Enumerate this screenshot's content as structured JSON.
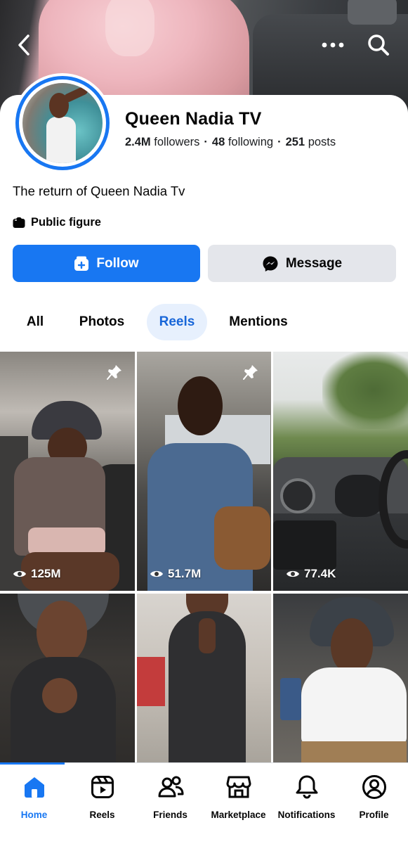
{
  "profile": {
    "name": "Queen Nadia TV",
    "followers_count": "2.4M",
    "followers_label": "followers",
    "following_count": "48",
    "following_label": "following",
    "posts_count": "251",
    "posts_label": "posts",
    "bio": "The return of Queen Nadia Tv",
    "category": "Public figure"
  },
  "actions": {
    "follow_label": "Follow",
    "message_label": "Message"
  },
  "tabs": [
    {
      "label": "All",
      "active": false
    },
    {
      "label": "Photos",
      "active": false
    },
    {
      "label": "Reels",
      "active": true
    },
    {
      "label": "Mentions",
      "active": false
    }
  ],
  "reels": [
    {
      "views": "125M",
      "pinned": true
    },
    {
      "views": "51.7M",
      "pinned": true
    },
    {
      "views": "77.4K",
      "pinned": false
    },
    {
      "views": "",
      "pinned": false
    },
    {
      "views": "",
      "pinned": false
    },
    {
      "views": "",
      "pinned": false
    }
  ],
  "bottom_nav": [
    {
      "label": "Home",
      "icon": "home-icon",
      "active": true
    },
    {
      "label": "Reels",
      "icon": "reels-icon",
      "active": false
    },
    {
      "label": "Friends",
      "icon": "friends-icon",
      "active": false
    },
    {
      "label": "Marketplace",
      "icon": "marketplace-icon",
      "active": false
    },
    {
      "label": "Notifications",
      "icon": "bell-icon",
      "active": false
    },
    {
      "label": "Profile",
      "icon": "profile-icon",
      "active": false
    }
  ],
  "colors": {
    "accent": "#1877f2",
    "message_bg": "#e4e6eb",
    "active_tab_bg": "#e7f0fd"
  }
}
